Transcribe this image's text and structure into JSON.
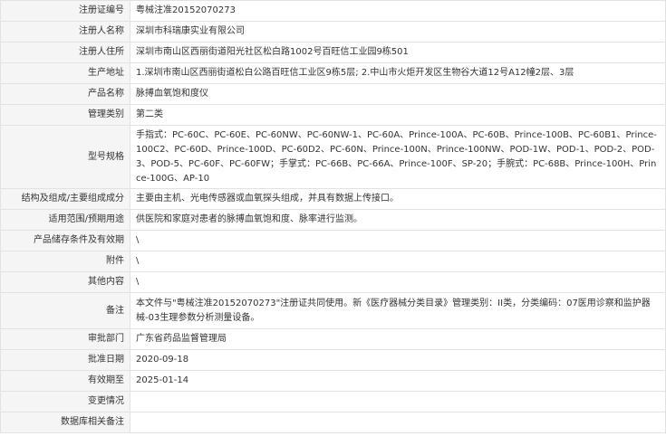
{
  "rows": [
    {
      "label": "注册证编号",
      "value": "粤械注准20152070273"
    },
    {
      "label": "注册人名称",
      "value": "深圳市科瑞康实业有限公司"
    },
    {
      "label": "注册人住所",
      "value": "深圳市南山区西丽街道阳光社区松白路1002号百旺信工业园9栋501"
    },
    {
      "label": "生产地址",
      "value": "1.深圳市南山区西丽街道松白公路百旺信工业区9栋5层; 2.中山市火炬开发区生物谷大道12号A12幢2层、3层"
    },
    {
      "label": "产品名称",
      "value": "脉搏血氧饱和度仪"
    },
    {
      "label": "管理类别",
      "value": "第二类"
    },
    {
      "label": "型号规格",
      "value": "手指式：PC-60C、PC-60E、PC-60NW、PC-60NW-1、PC-60A、Prince-100A、PC-60B、Prince-100B、PC-60B1、Prince-100C2、PC-60D、Prince-100D、PC-60D2、PC-60N、Prince-100N、Prince-100NW、POD-1W、POD-1、POD-2、POD-3、POD-5、PC-60F、PC-60FW；手掌式：PC-66B、PC-66A、Prince-100F、SP-20；手腕式：PC-68B、Prince-100H、Prince-100G、AP-10"
    },
    {
      "label": "结构及组成/主要组成成分",
      "value": "主要由主机、光电传感器或血氧探头组成，并具有数据上传接口。"
    },
    {
      "label": "适用范围/预期用途",
      "value": "供医院和家庭对患者的脉搏血氧饱和度、脉率进行监测。"
    },
    {
      "label": "产品储存条件及有效期",
      "value": "\\"
    },
    {
      "label": "附件",
      "value": "\\"
    },
    {
      "label": "其他内容",
      "value": "\\"
    },
    {
      "label": "备注",
      "value": "本文件与\"粤械注准20152070273\"注册证共同使用。新《医疗器械分类目录》管理类别：II类，分类编码：07医用诊察和监护器械-03生理参数分析测量设备。"
    },
    {
      "label": "审批部门",
      "value": "广东省药品监督管理局"
    },
    {
      "label": "批准日期",
      "value": "2020-09-18"
    },
    {
      "label": "有效期至",
      "value": "2025-01-14"
    },
    {
      "label": "变更情况",
      "value": ""
    },
    {
      "label": "数据库相关备注",
      "value": ""
    }
  ]
}
